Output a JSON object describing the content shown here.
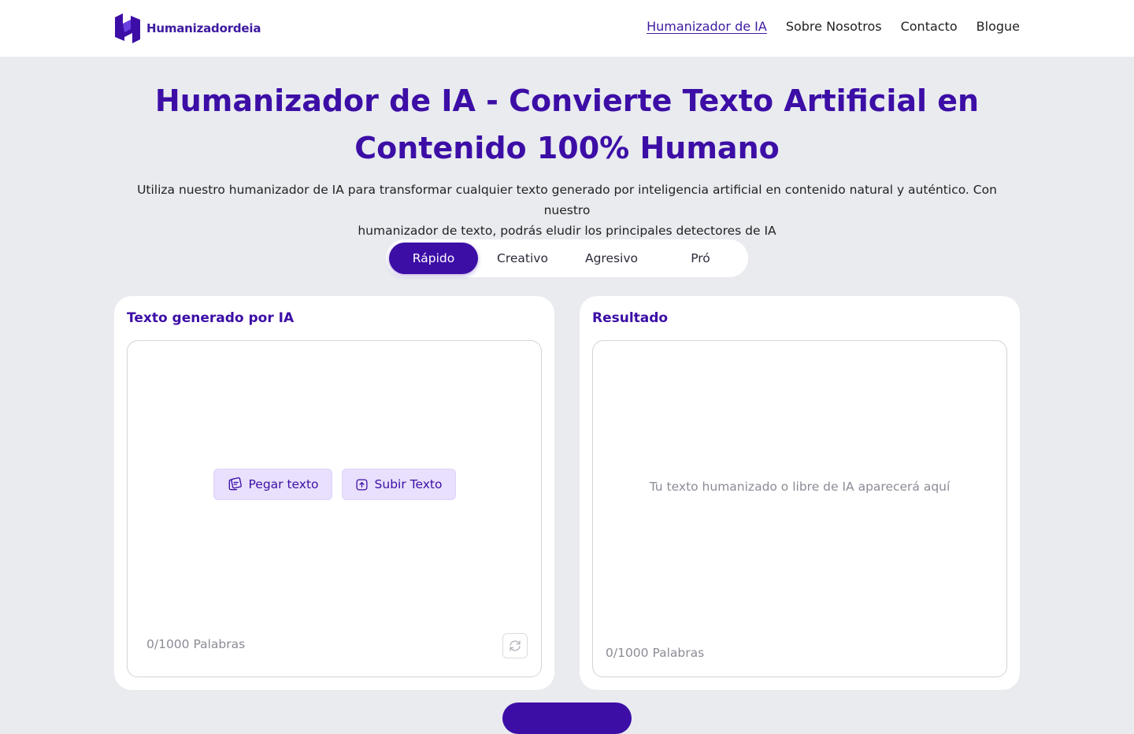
{
  "brand": {
    "name": "Humanizadordeia",
    "color": "#3c0ea6"
  },
  "nav": {
    "items": [
      {
        "label": "Humanizador de IA",
        "active": true
      },
      {
        "label": "Sobre Nosotros",
        "active": false
      },
      {
        "label": "Contacto",
        "active": false
      },
      {
        "label": "Blogue",
        "active": false
      }
    ]
  },
  "hero": {
    "title_line1": "Humanizador de IA - Convierte Texto Artificial en",
    "title_line2": "Contenido 100% Humano",
    "subtitle_line1": "Utiliza nuestro humanizador de IA para transformar cualquier texto generado por inteligencia artificial en contenido natural y auténtico. Con nuestro",
    "subtitle_line2": "humanizador de texto, podrás eludir los principales detectores de IA"
  },
  "modes": {
    "selected": "Rápido",
    "items": [
      "Rápido",
      "Creativo",
      "Agresivo",
      "Pró"
    ]
  },
  "input_panel": {
    "title": "Texto generado por IA",
    "paste_label": "Pegar texto",
    "upload_label": "Subir Texto",
    "word_count": "0/1000 Palabras",
    "icons": {
      "paste": "clipboard-icon",
      "upload": "upload-icon",
      "refresh": "refresh-icon"
    }
  },
  "output_panel": {
    "title": "Resultado",
    "placeholder": "Tu texto humanizado o libre de IA aparecerá aquí",
    "word_count": "0/1000 Palabras"
  }
}
